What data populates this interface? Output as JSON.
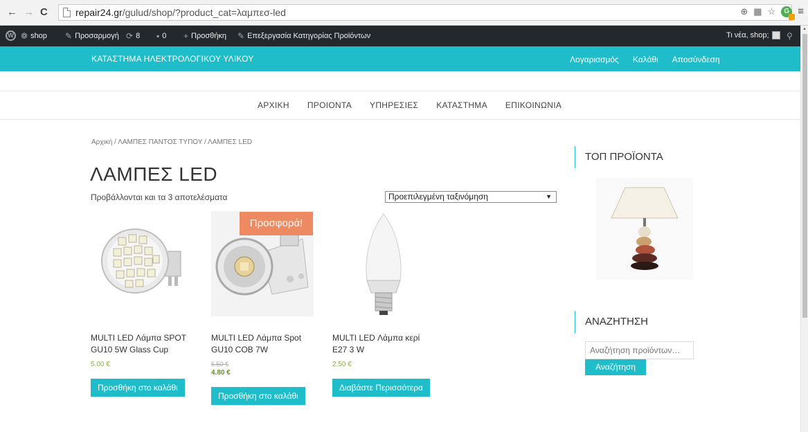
{
  "browser": {
    "url_domain": "repair24.gr",
    "url_path": "/gulud/shop/?product_cat=λαμπεσ-led"
  },
  "adminbar": {
    "site": "shop",
    "customize": "Προσαρμογή",
    "updates": "8",
    "comments": "0",
    "new": "Προσθήκη",
    "edit": "Επεξεργασία Κατηγορίας Προϊόντων",
    "greeting": "Τι νέα, shop;"
  },
  "header": {
    "site_title": "ΚΑΤΑΣΤΗΜΑ ΗΛΕΚΤΡΟΛΟΓΙΚΟΥ ΥΛΙΚΟΥ",
    "links": [
      "Λογαριασμός",
      "Καλάθι",
      "Αποσύνδεση"
    ]
  },
  "nav": {
    "items": [
      "ΑΡΧΙΚΗ",
      "ΠΡΟΙΟΝΤΑ",
      "ΥΠΗΡΕΣΙΕΣ",
      "ΚΑΤΑΣΤΗΜΑ",
      "ΕΠΙΚΟΙΝΩΝΙΑ"
    ]
  },
  "main": {
    "breadcrumb": "Αρχική / ΛΑΜΠΕΣ ΠΑΝΤΟΣ ΤΥΠΟΥ / ΛΑΜΠΕΣ LED",
    "title": "ΛΑΜΠΕΣ LED",
    "result_count": "Προβάλλονται και τα 3 αποτελέσματα",
    "sort_selected": "Προεπιλεγμένη ταξινόμηση",
    "sale_badge": "Προσφορά!",
    "products": [
      {
        "name": "MULTI LED Λάμπα SPOT GU10 5W Glass Cup",
        "price": "5.00 €",
        "button": "Προσθήκη στο καλάθι"
      },
      {
        "name": "MULTI LED Λάμπα Spot GU10 COB 7W",
        "old_price": "5.50 €",
        "price": "4.80 €",
        "button": "Προσθήκη στο καλάθι"
      },
      {
        "name": "MULTI LED Λάμπα κερί E27 3 W",
        "price": "2.50 €",
        "button": "Διαβάστε Περισσότερα"
      }
    ]
  },
  "sidebar": {
    "top_products_title": "ΤΟΠ ΠΡΟΪΟΝΤΑ",
    "search_title": "ΑΝΑΖΗΤΗΣΗ",
    "search_placeholder": "Αναζήτηση προϊόντων…",
    "search_button": "Αναζήτηση"
  }
}
